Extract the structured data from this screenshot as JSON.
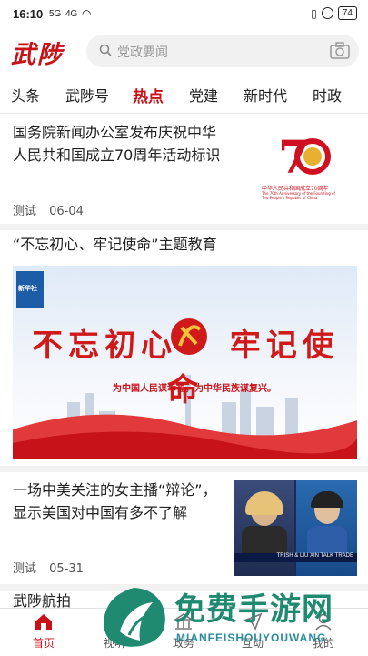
{
  "status_bar": {
    "time": "16:10",
    "signal_1": "5G",
    "signal_2": "4G",
    "battery": "74"
  },
  "header": {
    "logo": "武陟",
    "search_placeholder": "党政要闻"
  },
  "tabs": [
    {
      "label": "头条"
    },
    {
      "label": "武陟号"
    },
    {
      "label": "热点"
    },
    {
      "label": "党建"
    },
    {
      "label": "新时代"
    },
    {
      "label": "时政"
    }
  ],
  "active_tab": "热点",
  "news": [
    {
      "title": "国务院新闻办公室发布庆祝中华人民共和国成立70周年活动标识",
      "source": "测试",
      "date": "06-04",
      "thumb_caption_cn": "中华人民共和国成立70周年",
      "thumb_caption_en": "The 70th Anniversary of the Founding of The People's Republic of China",
      "thumb_number": "70"
    },
    {
      "title": "“不忘初心、牢记使命”主题教育",
      "banner_main": "不忘初心 牢记使命",
      "banner_sub": "为中国人民谋幸福，为中华民族谋复兴。",
      "banner_logo": "新华社"
    },
    {
      "title": "一场中美关注的女主播“辩论”，显示美国对中国有多不了解",
      "source": "测试",
      "date": "05-31",
      "thumb_ticker": "TRISH & LIU XIN TALK TRADE"
    },
    {
      "title": "武陟航拍"
    }
  ],
  "bottom_nav": [
    {
      "label": "首页",
      "icon": "home-icon"
    },
    {
      "label": "视听",
      "icon": "video-icon"
    },
    {
      "label": "政务",
      "icon": "gov-icon"
    },
    {
      "label": "互动",
      "icon": "send-icon"
    },
    {
      "label": "我的",
      "icon": "user-icon"
    }
  ],
  "watermark": {
    "text": "免费手游网",
    "sub": "MIANFEISHOUYOUWANG"
  },
  "colors": {
    "accent": "#c8121a",
    "divider": "#f2f2f2",
    "watermark": "#1f8a70"
  }
}
